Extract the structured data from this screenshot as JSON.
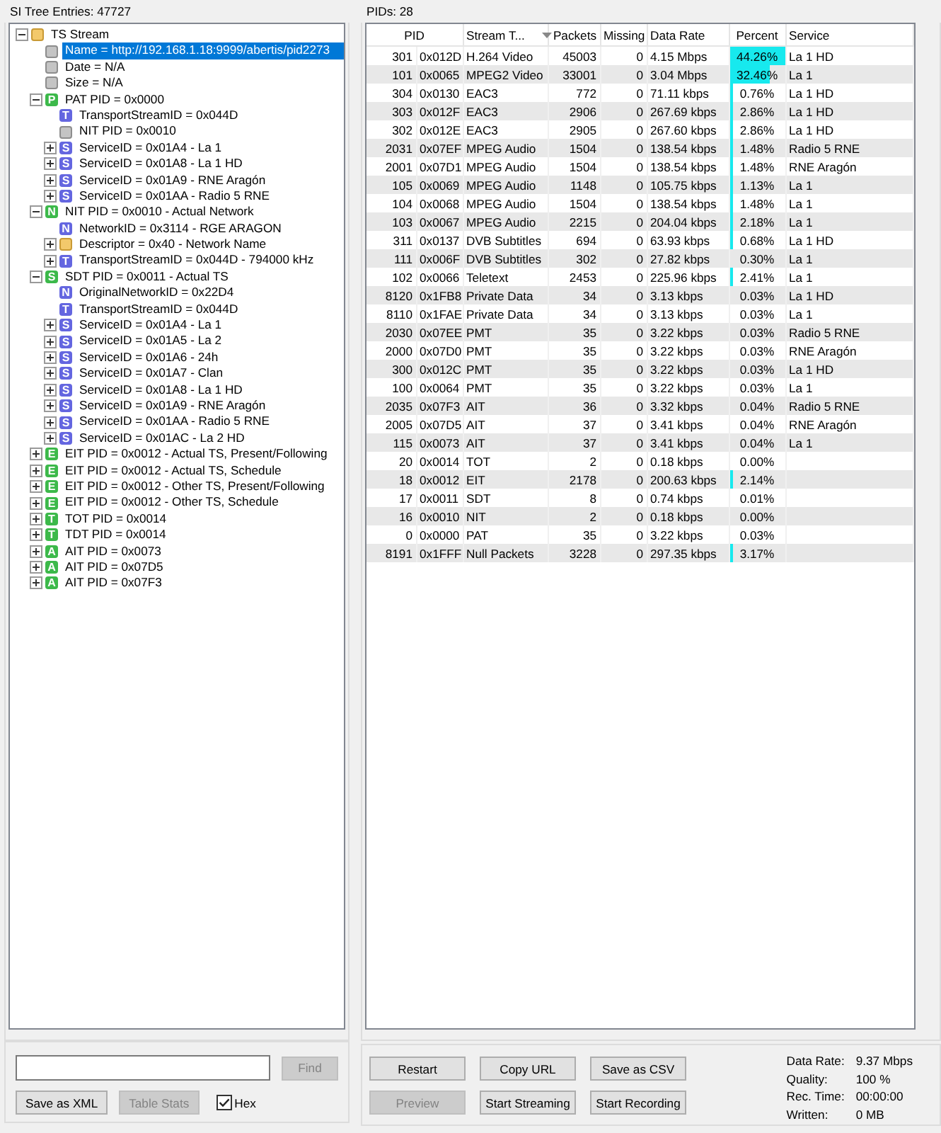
{
  "tree_panel": {
    "title": "SI Tree Entries: 47727",
    "nodes": [
      {
        "label": "TS Stream",
        "kind": "folder",
        "expanded": true,
        "selected": false,
        "children": [
          {
            "label": "Name = http://192.168.1.18:9999/abertis/pid2273",
            "kind": "field",
            "selected": true
          },
          {
            "label": "Date = N/A",
            "kind": "field",
            "selected": false
          },
          {
            "label": "Size = N/A",
            "kind": "field",
            "selected": false
          },
          {
            "label": "PAT PID = 0x0000",
            "kind": "table",
            "letter": "P",
            "expanded": true,
            "selected": false,
            "children": [
              {
                "label": "TransportStreamID = 0x044D",
                "kind": "entry",
                "letter": "T",
                "selected": false
              },
              {
                "label": "NIT PID = 0x0010",
                "kind": "field",
                "selected": false
              },
              {
                "label": "ServiceID = 0x01A4 - La 1",
                "kind": "entry",
                "letter": "S",
                "expanded": false,
                "selected": false
              },
              {
                "label": "ServiceID = 0x01A8 - La 1 HD",
                "kind": "entry",
                "letter": "S",
                "expanded": false,
                "selected": false
              },
              {
                "label": "ServiceID = 0x01A9 - RNE Aragón",
                "kind": "entry",
                "letter": "S",
                "expanded": false,
                "selected": false
              },
              {
                "label": "ServiceID = 0x01AA - Radio 5 RNE",
                "kind": "entry",
                "letter": "S",
                "expanded": false,
                "selected": false
              }
            ]
          },
          {
            "label": "NIT PID = 0x0010 - Actual Network",
            "kind": "table",
            "letter": "N",
            "expanded": true,
            "selected": false,
            "children": [
              {
                "label": "NetworkID = 0x3114 - RGE ARAGON",
                "kind": "entry",
                "letter": "N",
                "selected": false
              },
              {
                "label": "Descriptor = 0x40 - Network Name",
                "kind": "folder",
                "expanded": false,
                "selected": false
              },
              {
                "label": "TransportStreamID = 0x044D - 794000 kHz",
                "kind": "entry",
                "letter": "T",
                "expanded": false,
                "selected": false
              }
            ]
          },
          {
            "label": "SDT PID = 0x0011 - Actual TS",
            "kind": "table",
            "letter": "S",
            "expanded": true,
            "selected": false,
            "children": [
              {
                "label": "OriginalNetworkID = 0x22D4",
                "kind": "entry",
                "letter": "N",
                "selected": false
              },
              {
                "label": "TransportStreamID = 0x044D",
                "kind": "entry",
                "letter": "T",
                "selected": false
              },
              {
                "label": "ServiceID = 0x01A4 - La 1",
                "kind": "entry",
                "letter": "S",
                "expanded": false,
                "selected": false
              },
              {
                "label": "ServiceID = 0x01A5 - La 2",
                "kind": "entry",
                "letter": "S",
                "expanded": false,
                "selected": false
              },
              {
                "label": "ServiceID = 0x01A6 - 24h",
                "kind": "entry",
                "letter": "S",
                "expanded": false,
                "selected": false
              },
              {
                "label": "ServiceID = 0x01A7 - Clan",
                "kind": "entry",
                "letter": "S",
                "expanded": false,
                "selected": false
              },
              {
                "label": "ServiceID = 0x01A8 - La 1 HD",
                "kind": "entry",
                "letter": "S",
                "expanded": false,
                "selected": false
              },
              {
                "label": "ServiceID = 0x01A9 - RNE Aragón",
                "kind": "entry",
                "letter": "S",
                "expanded": false,
                "selected": false
              },
              {
                "label": "ServiceID = 0x01AA - Radio 5 RNE",
                "kind": "entry",
                "letter": "S",
                "expanded": false,
                "selected": false
              },
              {
                "label": "ServiceID = 0x01AC - La 2 HD",
                "kind": "entry",
                "letter": "S",
                "expanded": false,
                "selected": false
              }
            ]
          },
          {
            "label": "EIT PID = 0x0012 - Actual TS, Present/Following",
            "kind": "table",
            "letter": "E",
            "expanded": false,
            "selected": false
          },
          {
            "label": "EIT PID = 0x0012 - Actual TS, Schedule",
            "kind": "table",
            "letter": "E",
            "expanded": false,
            "selected": false
          },
          {
            "label": "EIT PID = 0x0012 - Other TS, Present/Following",
            "kind": "table",
            "letter": "E",
            "expanded": false,
            "selected": false
          },
          {
            "label": "EIT PID = 0x0012 - Other TS, Schedule",
            "kind": "table",
            "letter": "E",
            "expanded": false,
            "selected": false
          },
          {
            "label": "TOT PID = 0x0014",
            "kind": "table",
            "letter": "T",
            "expanded": false,
            "selected": false
          },
          {
            "label": "TDT PID = 0x0014",
            "kind": "table",
            "letter": "T",
            "expanded": false,
            "selected": false
          },
          {
            "label": "AIT PID = 0x0073",
            "kind": "table",
            "letter": "A",
            "expanded": false,
            "selected": false
          },
          {
            "label": "AIT PID = 0x07D5",
            "kind": "table",
            "letter": "A",
            "expanded": false,
            "selected": false
          },
          {
            "label": "AIT PID = 0x07F3",
            "kind": "table",
            "letter": "A",
            "expanded": false,
            "selected": false
          }
        ]
      }
    ]
  },
  "search_panel": {
    "find_button": {
      "label": "Find",
      "disabled": true
    },
    "buttons": [
      {
        "label": "Save as XML",
        "disabled": false
      },
      {
        "label": "Table Stats",
        "disabled": true
      }
    ],
    "hex_checkbox": {
      "label": "Hex",
      "checked": true
    }
  },
  "pid_panel": {
    "title": "PIDs: 28",
    "columns": [
      {
        "label": "PID",
        "sorted": false
      },
      {
        "label": "Stream T...",
        "sorted": true
      },
      {
        "label": "Packets",
        "sorted": false
      },
      {
        "label": "Missing",
        "sorted": false
      },
      {
        "label": "Data Rate",
        "sorted": false
      },
      {
        "label": "Percent",
        "sorted": false
      },
      {
        "label": "Service",
        "sorted": false
      }
    ],
    "rows": [
      {
        "pid": "301",
        "hex": "0x012D",
        "type": "H.264 Video",
        "packets": "45003",
        "missing": "0",
        "rate": "4.15 Mbps",
        "percent": "44.26%",
        "level": 1,
        "service": "La 1 HD"
      },
      {
        "pid": "101",
        "hex": "0x0065",
        "type": "MPEG2 Video",
        "packets": "33001",
        "missing": "0",
        "rate": "3.04 Mbps",
        "percent": "32.46%",
        "level": 0.733,
        "service": "La 1"
      },
      {
        "pid": "304",
        "hex": "0x0130",
        "type": "EAC3",
        "packets": "772",
        "missing": "0",
        "rate": "71.11 kbps",
        "percent": "0.76%",
        "level": 0.017,
        "service": "La 1 HD"
      },
      {
        "pid": "303",
        "hex": "0x012F",
        "type": "EAC3",
        "packets": "2906",
        "missing": "0",
        "rate": "267.69 kbps",
        "percent": "2.86%",
        "level": 0.065,
        "service": "La 1 HD"
      },
      {
        "pid": "302",
        "hex": "0x012E",
        "type": "EAC3",
        "packets": "2905",
        "missing": "0",
        "rate": "267.60 kbps",
        "percent": "2.86%",
        "level": 0.065,
        "service": "La 1 HD"
      },
      {
        "pid": "2031",
        "hex": "0x07EF",
        "type": "MPEG Audio",
        "packets": "1504",
        "missing": "0",
        "rate": "138.54 kbps",
        "percent": "1.48%",
        "level": 0.033,
        "service": "Radio 5 RNE"
      },
      {
        "pid": "2001",
        "hex": "0x07D1",
        "type": "MPEG Audio",
        "packets": "1504",
        "missing": "0",
        "rate": "138.54 kbps",
        "percent": "1.48%",
        "level": 0.033,
        "service": "RNE Aragón"
      },
      {
        "pid": "105",
        "hex": "0x0069",
        "type": "MPEG Audio",
        "packets": "1148",
        "missing": "0",
        "rate": "105.75 kbps",
        "percent": "1.13%",
        "level": 0.026,
        "service": "La 1"
      },
      {
        "pid": "104",
        "hex": "0x0068",
        "type": "MPEG Audio",
        "packets": "1504",
        "missing": "0",
        "rate": "138.54 kbps",
        "percent": "1.48%",
        "level": 0.033,
        "service": "La 1"
      },
      {
        "pid": "103",
        "hex": "0x0067",
        "type": "MPEG Audio",
        "packets": "2215",
        "missing": "0",
        "rate": "204.04 kbps",
        "percent": "2.18%",
        "level": 0.049,
        "service": "La 1"
      },
      {
        "pid": "311",
        "hex": "0x0137",
        "type": "DVB Subtitles",
        "packets": "694",
        "missing": "0",
        "rate": "63.93 kbps",
        "percent": "0.68%",
        "level": 0.015,
        "service": "La 1 HD"
      },
      {
        "pid": "111",
        "hex": "0x006F",
        "type": "DVB Subtitles",
        "packets": "302",
        "missing": "0",
        "rate": "27.82 kbps",
        "percent": "0.30%",
        "service": "La 1"
      },
      {
        "pid": "102",
        "hex": "0x0066",
        "type": "Teletext",
        "packets": "2453",
        "missing": "0",
        "rate": "225.96 kbps",
        "percent": "2.41%",
        "level": 0.054,
        "service": "La 1"
      },
      {
        "pid": "8120",
        "hex": "0x1FB8",
        "type": "Private Data",
        "packets": "34",
        "missing": "0",
        "rate": "3.13 kbps",
        "percent": "0.03%",
        "service": "La 1 HD"
      },
      {
        "pid": "8110",
        "hex": "0x1FAE",
        "type": "Private Data",
        "packets": "34",
        "missing": "0",
        "rate": "3.13 kbps",
        "percent": "0.03%",
        "service": "La 1"
      },
      {
        "pid": "2030",
        "hex": "0x07EE",
        "type": "PMT",
        "packets": "35",
        "missing": "0",
        "rate": "3.22 kbps",
        "percent": "0.03%",
        "service": "Radio 5 RNE"
      },
      {
        "pid": "2000",
        "hex": "0x07D0",
        "type": "PMT",
        "packets": "35",
        "missing": "0",
        "rate": "3.22 kbps",
        "percent": "0.03%",
        "service": "RNE Aragón"
      },
      {
        "pid": "300",
        "hex": "0x012C",
        "type": "PMT",
        "packets": "35",
        "missing": "0",
        "rate": "3.22 kbps",
        "percent": "0.03%",
        "service": "La 1 HD"
      },
      {
        "pid": "100",
        "hex": "0x0064",
        "type": "PMT",
        "packets": "35",
        "missing": "0",
        "rate": "3.22 kbps",
        "percent": "0.03%",
        "service": "La 1"
      },
      {
        "pid": "2035",
        "hex": "0x07F3",
        "type": "AIT",
        "packets": "36",
        "missing": "0",
        "rate": "3.32 kbps",
        "percent": "0.04%",
        "service": "Radio 5 RNE"
      },
      {
        "pid": "2005",
        "hex": "0x07D5",
        "type": "AIT",
        "packets": "37",
        "missing": "0",
        "rate": "3.41 kbps",
        "percent": "0.04%",
        "service": "RNE Aragón"
      },
      {
        "pid": "115",
        "hex": "0x0073",
        "type": "AIT",
        "packets": "37",
        "missing": "0",
        "rate": "3.41 kbps",
        "percent": "0.04%",
        "service": "La 1"
      },
      {
        "pid": "20",
        "hex": "0x0014",
        "type": "TOT",
        "packets": "2",
        "missing": "0",
        "rate": "0.18 kbps",
        "percent": "0.00%"
      },
      {
        "pid": "18",
        "hex": "0x0012",
        "type": "EIT",
        "packets": "2178",
        "missing": "0",
        "rate": "200.63 kbps",
        "percent": "2.14%",
        "level": 0.048
      },
      {
        "pid": "17",
        "hex": "0x0011",
        "type": "SDT",
        "packets": "8",
        "missing": "0",
        "rate": "0.74 kbps",
        "percent": "0.01%"
      },
      {
        "pid": "16",
        "hex": "0x0010",
        "type": "NIT",
        "packets": "2",
        "missing": "0",
        "rate": "0.18 kbps",
        "percent": "0.00%"
      },
      {
        "pid": "0",
        "hex": "0x0000",
        "type": "PAT",
        "packets": "35",
        "missing": "0",
        "rate": "3.22 kbps",
        "percent": "0.03%"
      },
      {
        "pid": "8191",
        "hex": "0x1FFF",
        "type": "Null Packets",
        "packets": "3228",
        "missing": "0",
        "rate": "297.35 kbps",
        "percent": "3.17%",
        "level": 0.072
      }
    ]
  },
  "action_panel": {
    "button_rows": [
      [
        {
          "label": "Restart",
          "disabled": false
        },
        {
          "label": "Copy URL",
          "disabled": false
        },
        {
          "label": "Save as CSV",
          "disabled": false
        }
      ],
      [
        {
          "label": "Preview",
          "disabled": true
        },
        {
          "label": "Start Streaming",
          "disabled": false
        },
        {
          "label": "Start Recording",
          "disabled": false
        }
      ]
    ],
    "stats": [
      {
        "label": "Data Rate:",
        "value": "9.37 Mbps"
      },
      {
        "label": "Quality:",
        "value": "100 %"
      },
      {
        "label": "Rec. Time:",
        "value": "00:00:00"
      },
      {
        "label": "Written:",
        "value": "0 MB"
      }
    ]
  }
}
